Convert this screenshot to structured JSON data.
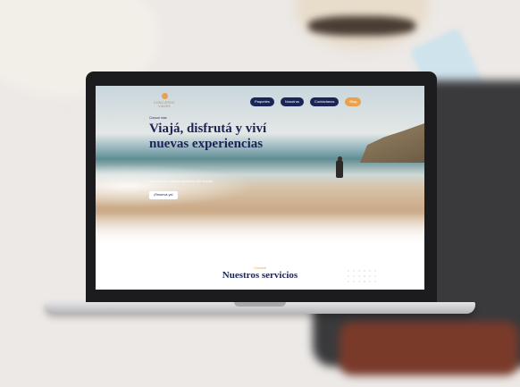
{
  "site": {
    "logo_line1": "CONCIERGE",
    "logo_line2": "VIAJES"
  },
  "nav": {
    "items": [
      "Paquetes",
      "Nosotros",
      "Contáctanos"
    ],
    "cta_label": "Blog"
  },
  "hero": {
    "kicker": "Conocé más",
    "title": "Viajá, disfrutá y viví nuevas experiencias",
    "subtitle": "Conocé los mejores destinos del mundo",
    "button_label": "¡Reservá ya!"
  },
  "services": {
    "kicker": "Conocé",
    "title": "Nuestros servicios"
  },
  "colors": {
    "brand_navy": "#1b2456",
    "accent_orange": "#e8a24b"
  }
}
